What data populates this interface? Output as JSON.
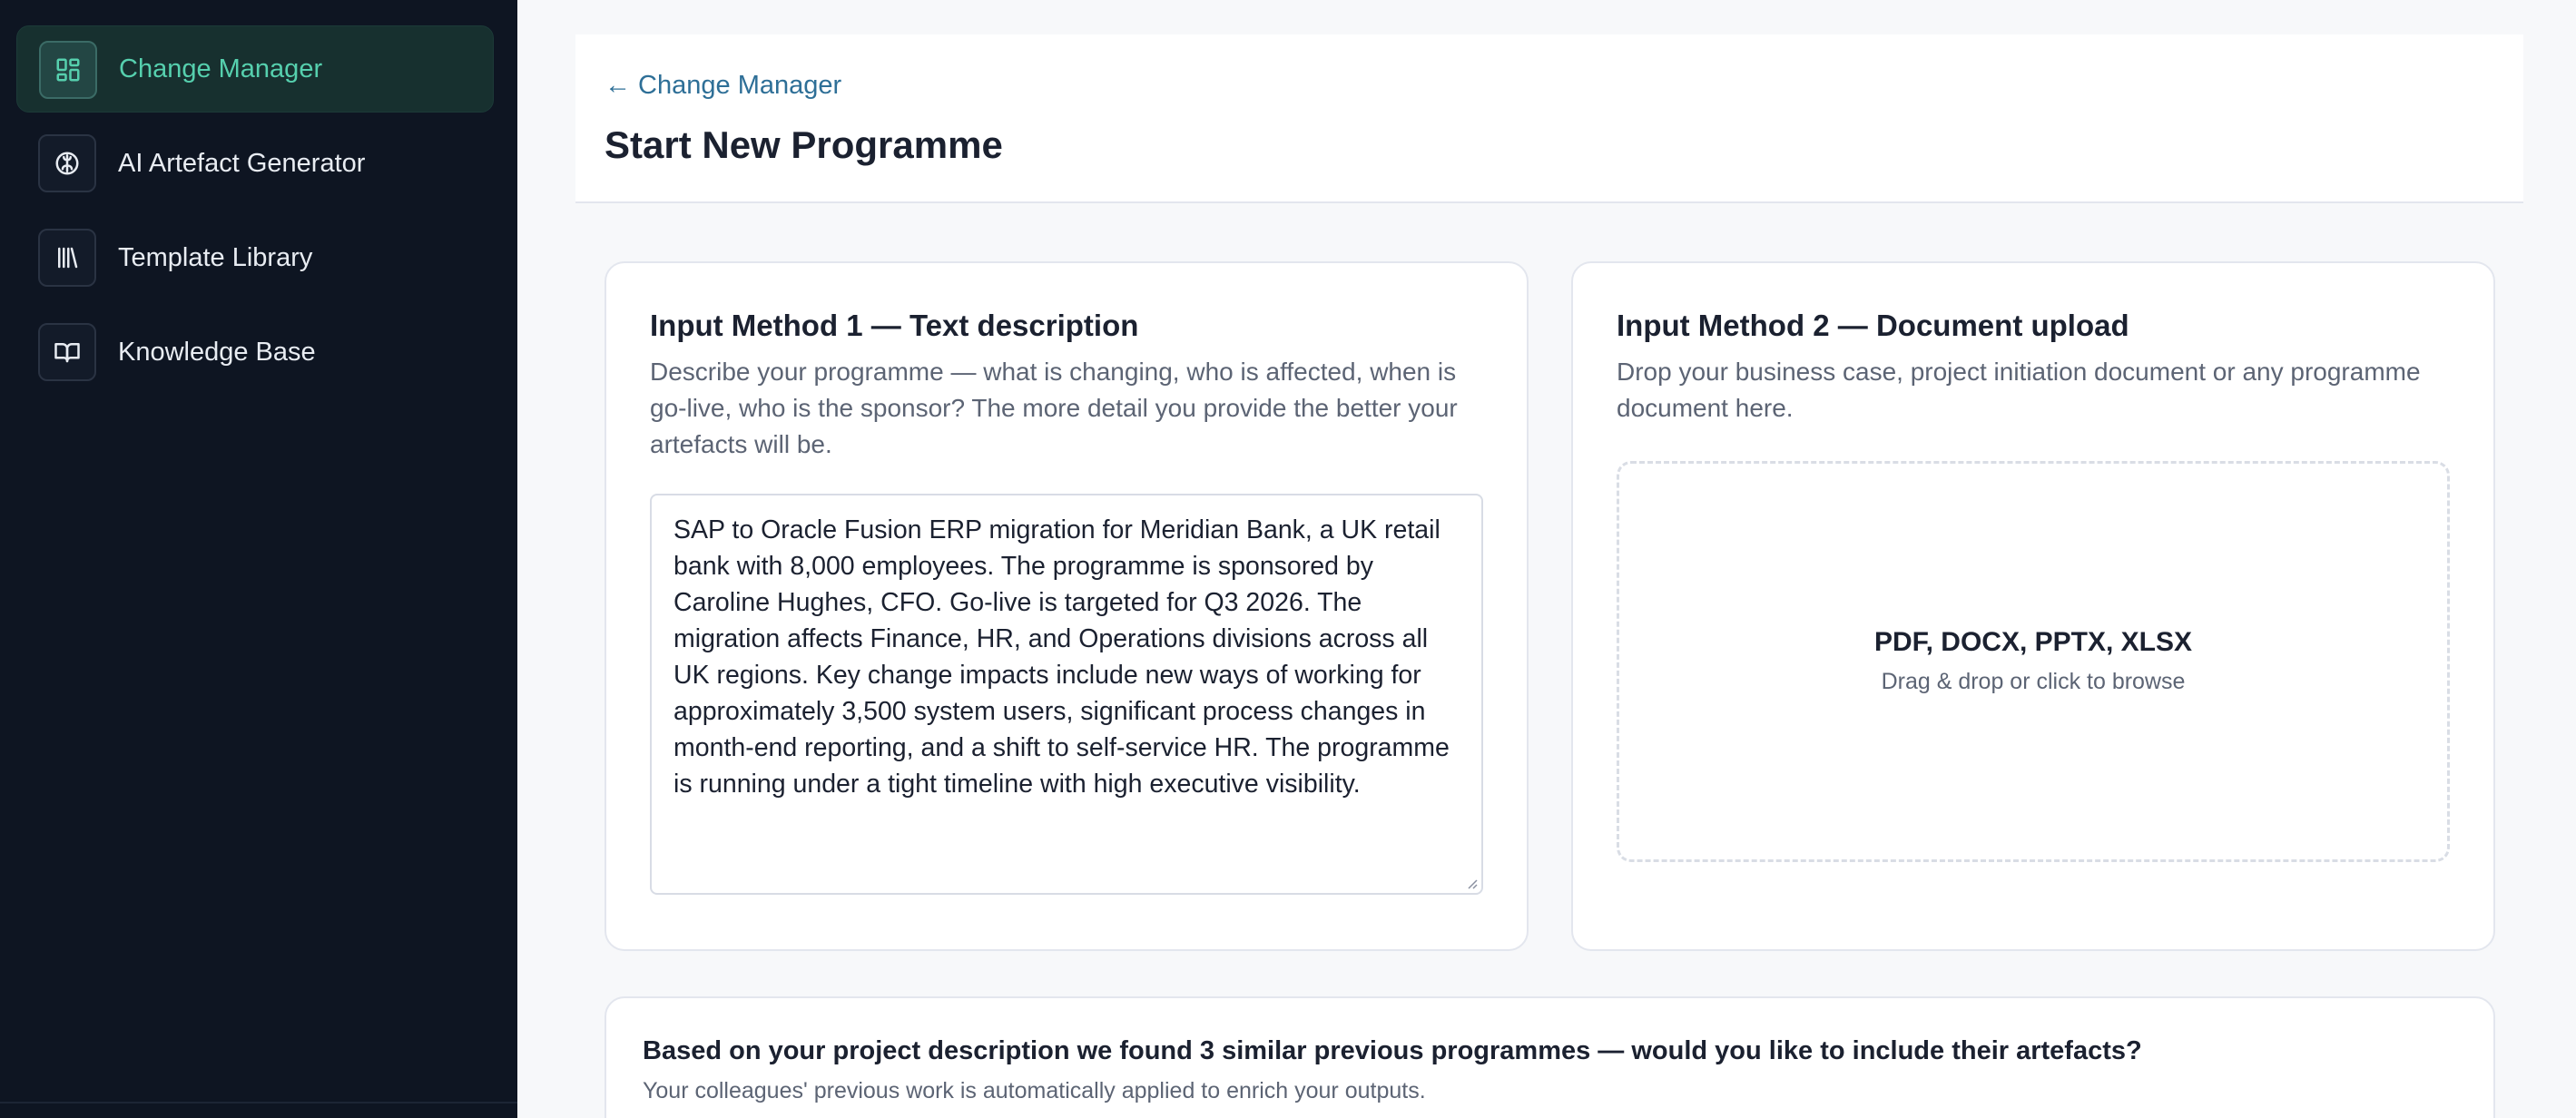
{
  "sidebar": {
    "items": [
      {
        "label": "Change Manager",
        "icon": "dashboard-grid-icon",
        "active": true
      },
      {
        "label": "AI Artefact Generator",
        "icon": "brain-icon",
        "active": false
      },
      {
        "label": "Template Library",
        "icon": "library-icon",
        "active": false
      },
      {
        "label": "Knowledge Base",
        "icon": "open-book-icon",
        "active": false
      }
    ]
  },
  "header": {
    "back_link": "← Change Manager",
    "title": "Start New Programme"
  },
  "input_text": {
    "title": "Input Method 1 — Text description",
    "description": "Describe your programme — what is changing, who is affected, when is go-live, who is the sponsor? The more detail you provide the better your artefacts will be.",
    "value": "SAP to Oracle Fusion ERP migration for Meridian Bank, a UK retail bank with 8,000 employees. The programme is sponsored by Caroline Hughes, CFO. Go-live is targeted for Q3 2026. The migration affects Finance, HR, and Operations divisions across all UK regions. Key change impacts include new ways of working for approximately 3,500 system users, significant process changes in month-end reporting, and a shift to self-service HR. The programme is running under a tight timeline with high executive visibility."
  },
  "input_upload": {
    "title": "Input Method 2 — Document upload",
    "description": "Drop your business case, project initiation document or any programme document here.",
    "formats": "PDF, DOCX, PPTX, XLSX",
    "hint": "Drag & drop or click to browse"
  },
  "similar": {
    "title": "Based on your project description we found 3 similar previous programmes — would you like to include their artefacts?",
    "subtitle": "Your colleagues' previous work is automatically applied to enrich your outputs."
  },
  "colors": {
    "sidebar_bg": "#0e1522",
    "accent": "#56d0ae",
    "link": "#2e6f97"
  }
}
